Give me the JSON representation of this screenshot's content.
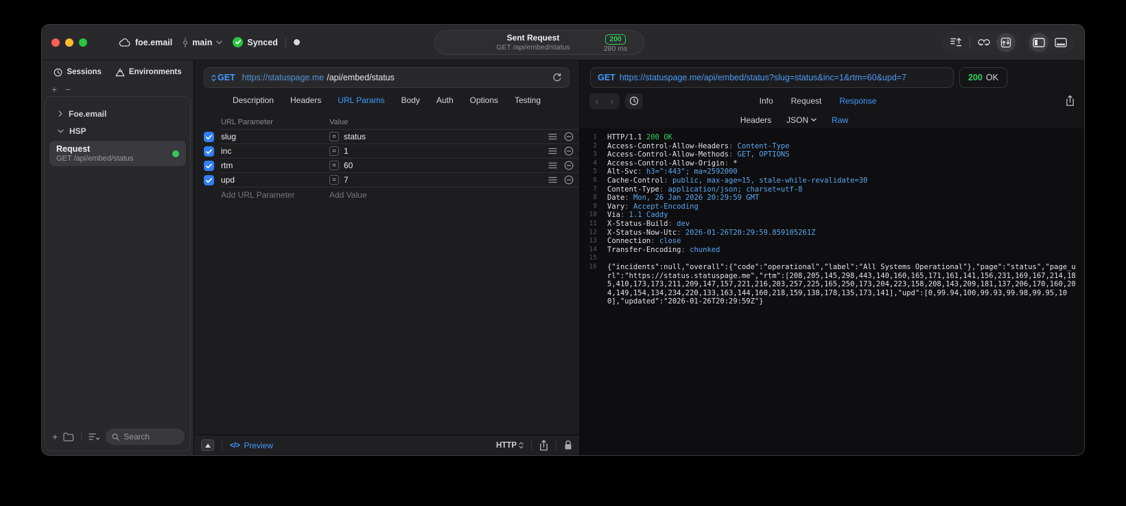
{
  "titlebar": {
    "project": "foe.email",
    "branch": "main",
    "sync": "Synced",
    "request_pill": {
      "title": "Sent Request",
      "subtitle": "GET /api/embed/status",
      "status": "200",
      "duration": "280 ms"
    }
  },
  "sidebar": {
    "tabs": [
      {
        "label": "Sessions"
      },
      {
        "label": "Environments"
      }
    ],
    "groups": [
      {
        "label": "Foe.email",
        "state": "collapsed"
      },
      {
        "label": "HSP",
        "state": "expanded"
      }
    ],
    "request_item": {
      "title": "Request",
      "subtitle": "GET /api/embed/status"
    },
    "search_placeholder": "Search"
  },
  "editor": {
    "method": "GET",
    "url_host": "https://statuspage.me",
    "url_path": "/api/embed/status",
    "tabs": [
      "Description",
      "Headers",
      "URL Params",
      "Body",
      "Auth",
      "Options",
      "Testing"
    ],
    "active_tab": "URL Params",
    "table": {
      "col_param": "URL Parameter",
      "col_value": "Value",
      "rows": [
        {
          "name": "slug",
          "value": "status",
          "checked": true
        },
        {
          "name": "inc",
          "value": "1",
          "checked": true
        },
        {
          "name": "rtm",
          "value": "60",
          "checked": true
        },
        {
          "name": "upd",
          "value": "7",
          "checked": true
        }
      ],
      "add_param": "Add URL Parameter",
      "add_value": "Add Value"
    },
    "footer": {
      "preview": "Preview",
      "protocol": "HTTP"
    }
  },
  "response": {
    "method": "GET",
    "url": "https://statuspage.me/api/embed/status?slug=status&inc=1&rtm=60&upd=7",
    "status": "200",
    "status_text": "OK",
    "tabs": [
      "Info",
      "Request",
      "Response"
    ],
    "active_tab": "Response",
    "subtabs": [
      "Headers",
      "JSON",
      "Raw"
    ],
    "active_subtab": "Raw",
    "lines": [
      {
        "n": "1",
        "seg": [
          [
            "HTTP/1.1 ",
            "w"
          ],
          [
            "200 OK",
            "g"
          ]
        ]
      },
      {
        "n": "2",
        "seg": [
          [
            "Access-Control-Allow-Headers",
            "w"
          ],
          [
            ": ",
            "d"
          ],
          [
            "Content-Type",
            "b"
          ]
        ]
      },
      {
        "n": "3",
        "seg": [
          [
            "Access-Control-Allow-Methods",
            "w"
          ],
          [
            ": ",
            "d"
          ],
          [
            "GET, OPTIONS",
            "b"
          ]
        ]
      },
      {
        "n": "4",
        "seg": [
          [
            "Access-Control-Allow-Origin",
            "w"
          ],
          [
            ": ",
            "d"
          ],
          [
            "*",
            "w"
          ]
        ]
      },
      {
        "n": "5",
        "seg": [
          [
            "Alt-Svc",
            "w"
          ],
          [
            ": ",
            "d"
          ],
          [
            "h3=\":443\"; ma=2592000",
            "b"
          ]
        ]
      },
      {
        "n": "6",
        "seg": [
          [
            "Cache-Control",
            "w"
          ],
          [
            ": ",
            "d"
          ],
          [
            "public, max-age=15, stale-while-revalidate=30",
            "b"
          ]
        ]
      },
      {
        "n": "7",
        "seg": [
          [
            "Content-Type",
            "w"
          ],
          [
            ": ",
            "d"
          ],
          [
            "application/json; charset=utf-8",
            "b"
          ]
        ]
      },
      {
        "n": "8",
        "seg": [
          [
            "Date",
            "w"
          ],
          [
            ": ",
            "d"
          ],
          [
            "Mon, 26 Jan 2026 20:29:59 GMT",
            "b"
          ]
        ]
      },
      {
        "n": "9",
        "seg": [
          [
            "Vary",
            "w"
          ],
          [
            ": ",
            "d"
          ],
          [
            "Accept-Encoding",
            "b"
          ]
        ]
      },
      {
        "n": "10",
        "seg": [
          [
            "Via",
            "w"
          ],
          [
            ": ",
            "d"
          ],
          [
            "1.1 Caddy",
            "b"
          ]
        ]
      },
      {
        "n": "11",
        "seg": [
          [
            "X-Status-Build",
            "w"
          ],
          [
            ": ",
            "d"
          ],
          [
            "dev",
            "b"
          ]
        ]
      },
      {
        "n": "12",
        "seg": [
          [
            "X-Status-Now-Utc",
            "w"
          ],
          [
            ": ",
            "d"
          ],
          [
            "2026-01-26T20:29:59.859105261Z",
            "b"
          ]
        ]
      },
      {
        "n": "13",
        "seg": [
          [
            "Connection",
            "w"
          ],
          [
            ": ",
            "d"
          ],
          [
            "close",
            "b"
          ]
        ]
      },
      {
        "n": "14",
        "seg": [
          [
            "Transfer-Encoding",
            "w"
          ],
          [
            ": ",
            "d"
          ],
          [
            "chunked",
            "b"
          ]
        ]
      },
      {
        "n": "15",
        "seg": []
      },
      {
        "n": "16",
        "seg": [
          [
            "{\"incidents\":null,\"overall\":{\"code\":\"operational\",\"label\":\"All Systems Operational\"},\"page\":\"status\",\"page_url\":\"https://status.statuspage.me\",\"rtm\":[208,205,145,298,443,140,160,165,171,161,141,156,231,169,167,214,185,410,173,173,211,209,147,157,221,216,203,257,225,165,250,173,204,223,158,208,143,209,181,137,206,170,160,204,149,154,134,234,220,133,163,144,160,218,159,138,178,135,173,141],\"upd\":[0,99.94,100,99.93,99.98,99.95,100],\"updated\":\"2026-01-26T20:29:59Z\"}",
            "w"
          ]
        ]
      }
    ]
  },
  "colors": {
    "accent_blue": "#3f9bff",
    "green": "#30d158",
    "checkbox_blue": "#2f7ff6",
    "red_light": "#ff5f57",
    "yellow_light": "#febc2e",
    "green_light": "#28c840"
  }
}
